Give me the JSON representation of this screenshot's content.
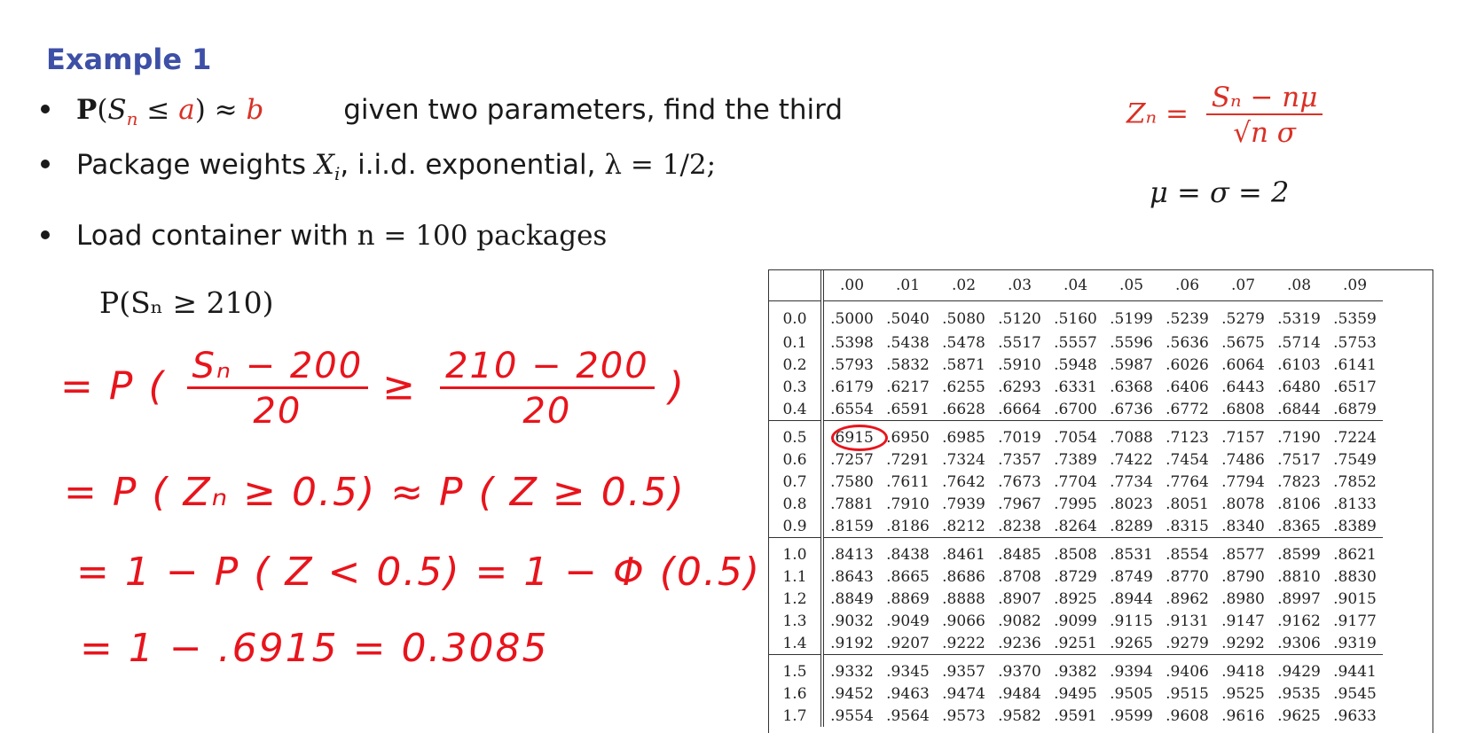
{
  "title": "Example 1",
  "bullets": {
    "b1_expr_P": "P",
    "b1_text": "given two parameters, find the third",
    "b2_text_a": "Package weights",
    "b2_text_b": ", i.i.d. exponential,",
    "b2_lambda": "λ = 1/2;",
    "b3_text": "Load container with",
    "b3_n": "n = 100 packages"
  },
  "formulas": {
    "z_lhs": "Zₙ =",
    "z_num": "Sₙ − nμ",
    "z_den": "√n σ",
    "musigma": "μ = σ = 2",
    "prob": "P(Sₙ ≥ 210)"
  },
  "handwriting": {
    "line1a": "= P (",
    "line1_num1": "Sₙ − 200",
    "line1_den1": "20",
    "line1_geq": "≥",
    "line1_num2": "210 − 200",
    "line1_den2": "20",
    "line1_close": ")",
    "line2": "= P ( Zₙ ≥ 0.5) ≈ P ( Z ≥ 0.5)",
    "line3": "= 1 − P ( Z < 0.5) = 1 − Φ (0.5)",
    "line4": "= 1 − .6915 = 0.3085"
  },
  "table": {
    "columns": [
      "",
      ".00",
      ".01",
      ".02",
      ".03",
      ".04",
      ".05",
      ".06",
      ".07",
      ".08",
      ".09"
    ],
    "rows": [
      [
        "0.0",
        ".5000",
        ".5040",
        ".5080",
        ".5120",
        ".5160",
        ".5199",
        ".5239",
        ".5279",
        ".5319",
        ".5359"
      ],
      [
        "0.1",
        ".5398",
        ".5438",
        ".5478",
        ".5517",
        ".5557",
        ".5596",
        ".5636",
        ".5675",
        ".5714",
        ".5753"
      ],
      [
        "0.2",
        ".5793",
        ".5832",
        ".5871",
        ".5910",
        ".5948",
        ".5987",
        ".6026",
        ".6064",
        ".6103",
        ".6141"
      ],
      [
        "0.3",
        ".6179",
        ".6217",
        ".6255",
        ".6293",
        ".6331",
        ".6368",
        ".6406",
        ".6443",
        ".6480",
        ".6517"
      ],
      [
        "0.4",
        ".6554",
        ".6591",
        ".6628",
        ".6664",
        ".6700",
        ".6736",
        ".6772",
        ".6808",
        ".6844",
        ".6879"
      ],
      [
        "0.5",
        ".6915",
        ".6950",
        ".6985",
        ".7019",
        ".7054",
        ".7088",
        ".7123",
        ".7157",
        ".7190",
        ".7224"
      ],
      [
        "0.6",
        ".7257",
        ".7291",
        ".7324",
        ".7357",
        ".7389",
        ".7422",
        ".7454",
        ".7486",
        ".7517",
        ".7549"
      ],
      [
        "0.7",
        ".7580",
        ".7611",
        ".7642",
        ".7673",
        ".7704",
        ".7734",
        ".7764",
        ".7794",
        ".7823",
        ".7852"
      ],
      [
        "0.8",
        ".7881",
        ".7910",
        ".7939",
        ".7967",
        ".7995",
        ".8023",
        ".8051",
        ".8078",
        ".8106",
        ".8133"
      ],
      [
        "0.9",
        ".8159",
        ".8186",
        ".8212",
        ".8238",
        ".8264",
        ".8289",
        ".8315",
        ".8340",
        ".8365",
        ".8389"
      ],
      [
        "1.0",
        ".8413",
        ".8438",
        ".8461",
        ".8485",
        ".8508",
        ".8531",
        ".8554",
        ".8577",
        ".8599",
        ".8621"
      ],
      [
        "1.1",
        ".8643",
        ".8665",
        ".8686",
        ".8708",
        ".8729",
        ".8749",
        ".8770",
        ".8790",
        ".8810",
        ".8830"
      ],
      [
        "1.2",
        ".8849",
        ".8869",
        ".8888",
        ".8907",
        ".8925",
        ".8944",
        ".8962",
        ".8980",
        ".8997",
        ".9015"
      ],
      [
        "1.3",
        ".9032",
        ".9049",
        ".9066",
        ".9082",
        ".9099",
        ".9115",
        ".9131",
        ".9147",
        ".9162",
        ".9177"
      ],
      [
        "1.4",
        ".9192",
        ".9207",
        ".9222",
        ".9236",
        ".9251",
        ".9265",
        ".9279",
        ".9292",
        ".9306",
        ".9319"
      ],
      [
        "1.5",
        ".9332",
        ".9345",
        ".9357",
        ".9370",
        ".9382",
        ".9394",
        ".9406",
        ".9418",
        ".9429",
        ".9441"
      ],
      [
        "1.6",
        ".9452",
        ".9463",
        ".9474",
        ".9484",
        ".9495",
        ".9505",
        ".9515",
        ".9525",
        ".9535",
        ".9545"
      ],
      [
        "1.7",
        ".9554",
        ".9564",
        ".9573",
        ".9582",
        ".9591",
        ".9599",
        ".9608",
        ".9616",
        ".9625",
        ".9633"
      ]
    ]
  },
  "colors": {
    "title": "#3d4fa6",
    "red": "#d93025",
    "handwriting": "#e8141c"
  }
}
